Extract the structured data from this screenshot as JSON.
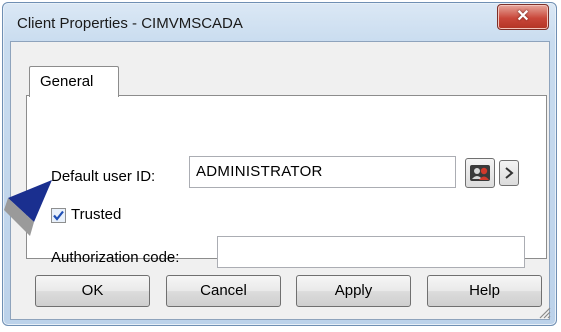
{
  "window": {
    "title": "Client Properties - CIMVMSCADA"
  },
  "tabs": [
    {
      "label": "General"
    }
  ],
  "general": {
    "default_user_label": "Default user ID:",
    "default_user_value": "ADMINISTRATOR",
    "trusted_label": "Trusted",
    "trusted_checked": true,
    "auth_label": "Authorization code:",
    "auth_value": ""
  },
  "buttons": {
    "ok": "OK",
    "cancel": "Cancel",
    "apply": "Apply",
    "help": "Help"
  },
  "icons": {
    "close": "close-icon",
    "user_browse": "users-icon",
    "more": "chevron-right-icon",
    "pointer": "pointer-arrow-icon"
  },
  "colors": {
    "close_button": "#c9473a",
    "pointer": "#1a2f8f",
    "check": "#1f4fb5"
  }
}
